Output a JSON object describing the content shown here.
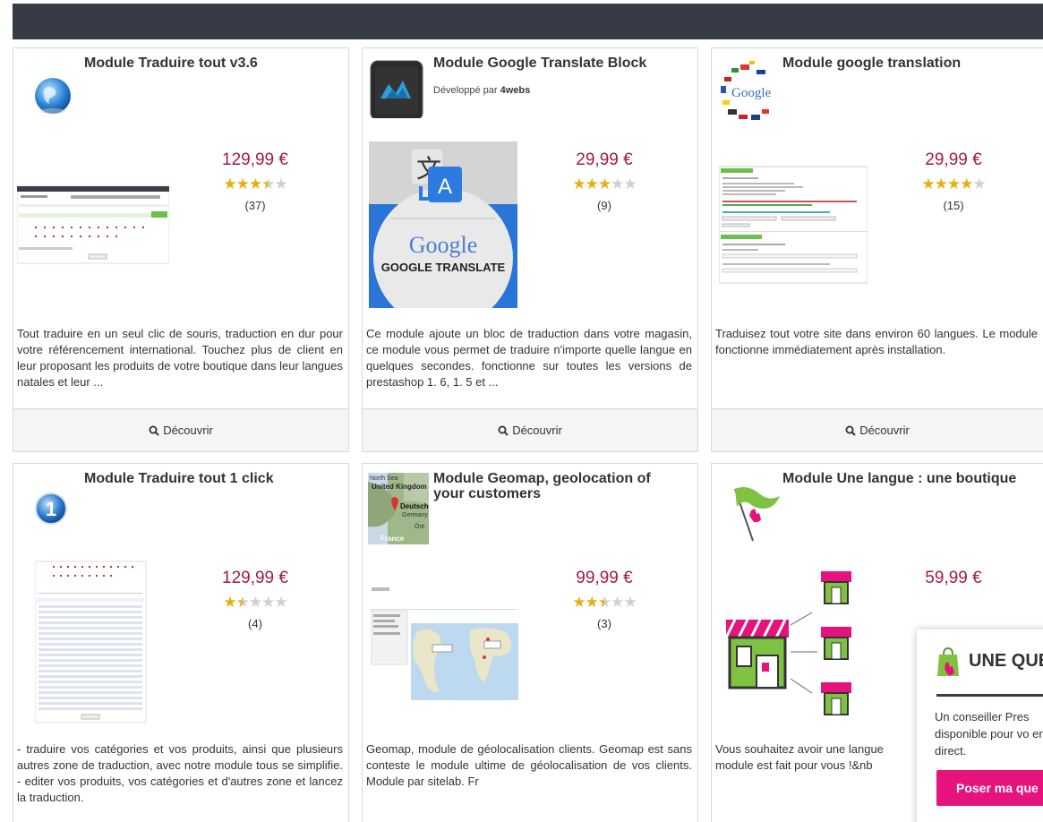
{
  "colors": {
    "topbar": "#363b45",
    "price": "#9f1b4b",
    "star_on": "#e5b00f",
    "star_off": "#cfcfcf",
    "chat_button": "#e5137b"
  },
  "discover_label": "Découvrir",
  "modules": [
    {
      "title": "Module Traduire tout v3.6",
      "developer_prefix": "",
      "developer": "",
      "price": "129,99 €",
      "rating": 3.5,
      "reviews": "(37)",
      "description": "Tout traduire en un seul clic de souris, traduction en dur pour votre référencement international. Touchez plus de client en leur proposant les produits de votre boutique dans leur langues natales et leur ...",
      "logo_icon": "globe-icon"
    },
    {
      "title": "Module Google Translate Block",
      "developer_prefix": "Développé par ",
      "developer": "4webs",
      "price": "29,99 €",
      "rating": 3,
      "reviews": "(9)",
      "description": "Ce module ajoute un bloc de traduction dans votre magasin, ce module vous permet de traduire n'importe quelle langue en quelques secondes. fonctionne sur toutes les versions de prestashop 1. 6, 1. 5 et ...",
      "logo_icon": "4webs-logo-icon",
      "image_text_1": "Google",
      "image_text_2": "GOOGLE TRANSLATE"
    },
    {
      "title": "Module google translation",
      "developer_prefix": "",
      "developer": "",
      "price": "29,99 €",
      "rating": 4,
      "reviews": "(15)",
      "description": "Traduisez tout votre site dans environ 60 langues. Le module fonctionne immédiatement après installation.",
      "logo_icon": "google-flags-icon",
      "logo_text": "Google"
    },
    {
      "title": "Module Traduire tout 1 click",
      "developer_prefix": "",
      "developer": "",
      "price": "129,99 €",
      "rating": 1.5,
      "reviews": "(4)",
      "description": "- traduire vos catégories et vos produits, ainsi que plusieurs autres zone de traduction, avec notre module tous se simplifie. - editer vos produits, vos catégories et d'autres zone et lancez la traduction.",
      "logo_icon": "number-one-icon"
    },
    {
      "title": "Module Geomap, geolocation of your customers",
      "developer_prefix": "",
      "developer": "",
      "price": "99,99 €",
      "rating": 2.5,
      "reviews": "(3)",
      "description": "Geomap, module de géolocalisation clients. Geomap est sans conteste le module ultime de géolocalisation de vos clients. Module par sitelab. Fr",
      "logo_icon": "map-icon",
      "logo_labels": [
        "North Sea",
        "United Kingdom",
        "Deutschla",
        "Germany",
        "France",
        "Öst"
      ]
    },
    {
      "title": "Module Une langue : une boutique",
      "developer_prefix": "",
      "developer": "",
      "price": "59,99 €",
      "rating": null,
      "reviews": "",
      "description": "Vous souhaitez avoir une langue module est fait pour vous !&nb",
      "logo_icon": "flag-cursor-icon"
    }
  ],
  "chat": {
    "title": "UNE QUE",
    "text": "Un conseiller Pres disponible pour vo en direct.",
    "button": "Poser ma que"
  }
}
